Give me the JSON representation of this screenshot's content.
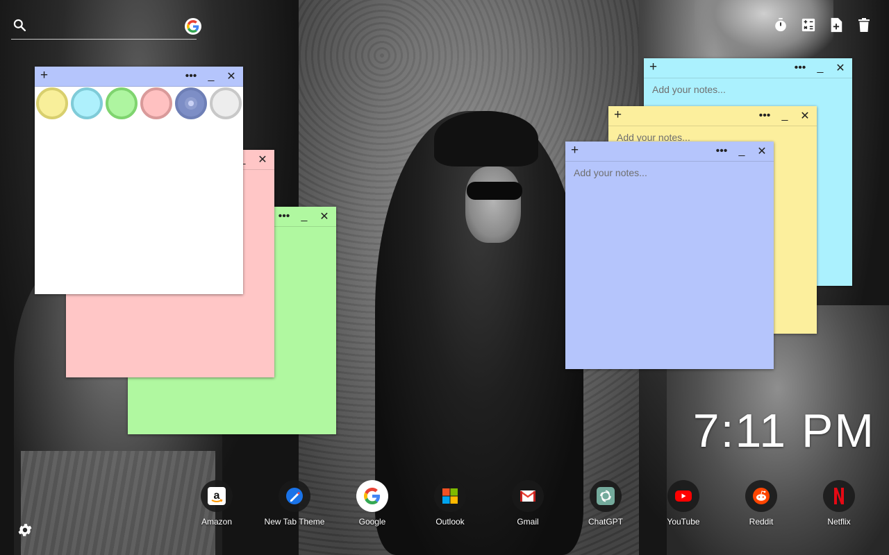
{
  "search": {
    "value": "",
    "placeholder": ""
  },
  "toolbar": {
    "icons": [
      "timer-icon",
      "calculator-icon",
      "add-note-icon",
      "trash-icon"
    ]
  },
  "notes": {
    "add_symbol": "+",
    "menu_symbol": "•••",
    "minimize_symbol": "_",
    "close_symbol": "✕",
    "placeholder": "Add your notes...",
    "colors": {
      "white": "#ffffff",
      "pink": "#ffc6c6",
      "green": "#b0f8a0",
      "blue": "#abf1fe",
      "yellow": "#fcef9d",
      "purple": "#b5c5fc"
    },
    "palette": [
      {
        "name": "yellow",
        "fill": "#f8ef9a",
        "ring": "#d8cf6e"
      },
      {
        "name": "blue",
        "fill": "#aef0fc",
        "ring": "#7fcbd8"
      },
      {
        "name": "green",
        "fill": "#aef5a0",
        "ring": "#7fd46f"
      },
      {
        "name": "pink",
        "fill": "#ffc1c1",
        "ring": "#d99a9a"
      },
      {
        "name": "purple",
        "fill": "#8f9ed0",
        "ring": "#6e7fb6"
      },
      {
        "name": "gray",
        "fill": "#ededed",
        "ring": "#c8c8c8"
      }
    ]
  },
  "clock": {
    "time": "7:11 PM"
  },
  "shortcuts": [
    {
      "label": "Amazon",
      "icon": "amazon-icon"
    },
    {
      "label": "New Tab Theme",
      "icon": "new-tab-theme-icon"
    },
    {
      "label": "Google",
      "icon": "google-icon"
    },
    {
      "label": "Outlook",
      "icon": "outlook-icon"
    },
    {
      "label": "Gmail",
      "icon": "gmail-icon"
    },
    {
      "label": "ChatGPT",
      "icon": "chatgpt-icon"
    },
    {
      "label": "YouTube",
      "icon": "youtube-icon"
    },
    {
      "label": "Reddit",
      "icon": "reddit-icon"
    },
    {
      "label": "Netflix",
      "icon": "netflix-icon"
    }
  ]
}
